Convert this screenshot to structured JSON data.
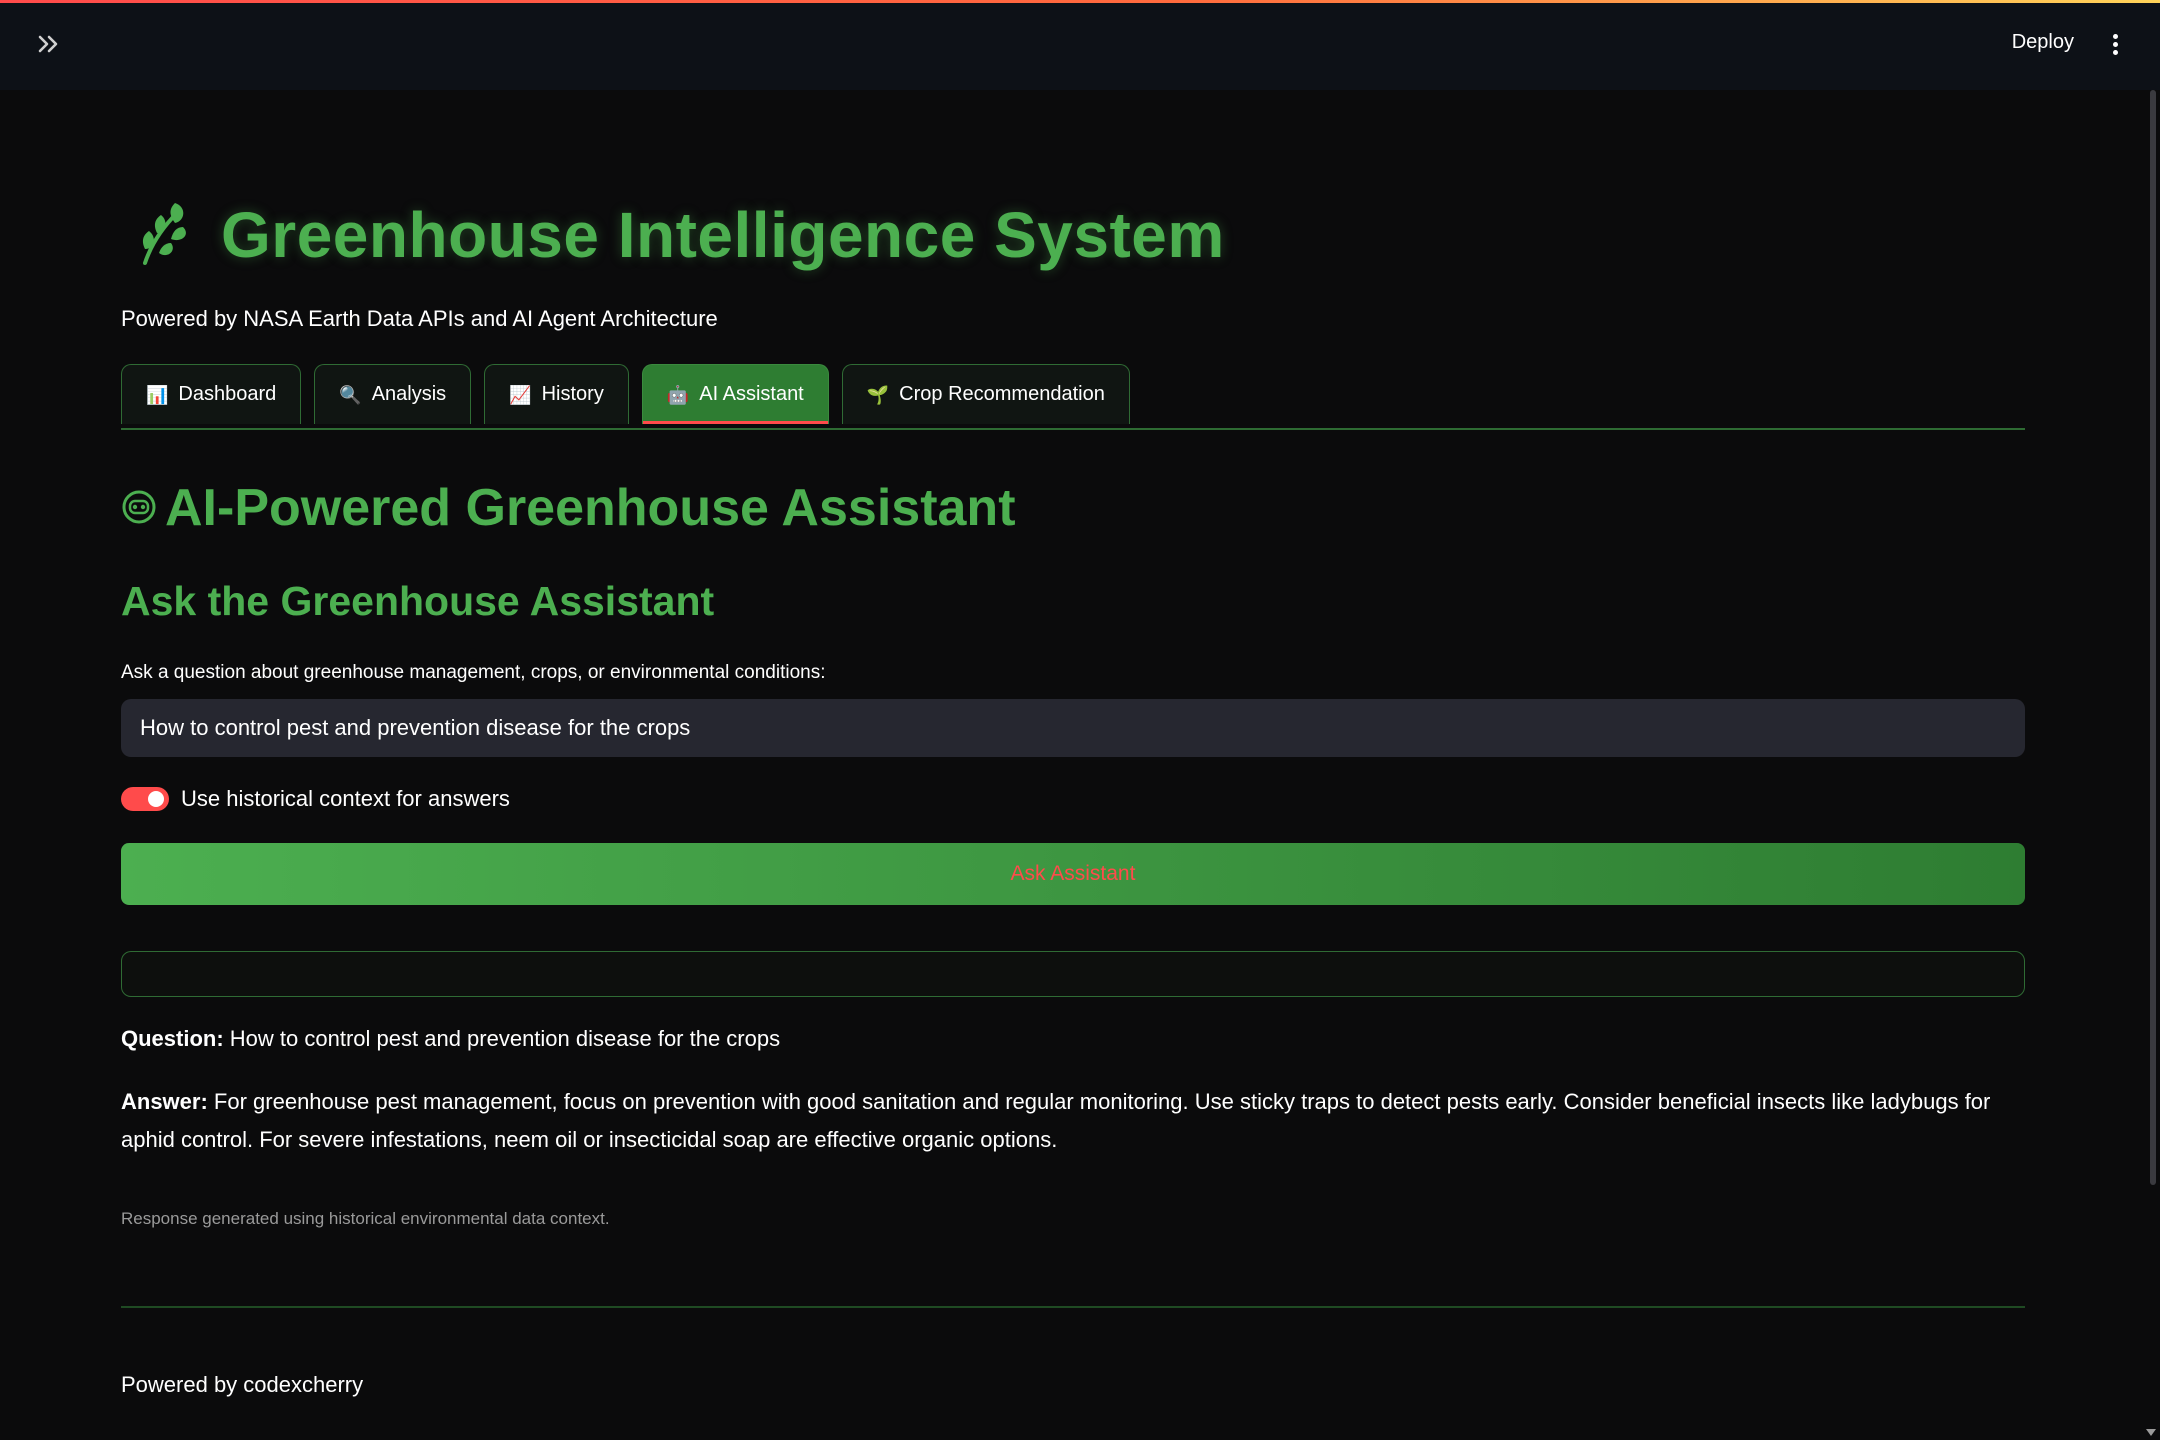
{
  "topbar": {
    "deploy_label": "Deploy",
    "sidebar_toggle_icon": "double-chevron-right-icon",
    "menu_icon": "kebab-menu-icon"
  },
  "app": {
    "title": "Greenhouse Intelligence System",
    "title_icon": "herb-leaf-icon",
    "subtitle": "Powered by NASA Earth Data APIs and AI Agent Architecture"
  },
  "tabs": [
    {
      "icon": "📊",
      "label": "Dashboard",
      "active": false
    },
    {
      "icon": "🔍",
      "label": "Analysis",
      "active": false
    },
    {
      "icon": "📈",
      "label": "History",
      "active": false
    },
    {
      "icon": "🤖",
      "label": "AI Assistant",
      "active": true
    },
    {
      "icon": "🌱",
      "label": "Crop Recommendation",
      "active": false
    }
  ],
  "assistant": {
    "heading": "AI-Powered Greenhouse Assistant",
    "heading_icon": "robot-icon",
    "subheading": "Ask the Greenhouse Assistant",
    "input_label": "Ask a question about greenhouse management, crops, or environmental conditions:",
    "input_value": "How to control pest and prevention disease for the crops",
    "toggle_label": "Use historical context for answers",
    "toggle_on": true,
    "ask_button_label": "Ask Assistant",
    "question_label": "Question:",
    "question_text": "How to control pest and prevention disease for the crops",
    "answer_label": "Answer:",
    "answer_text": "For greenhouse pest management, focus on prevention with good sanitation and regular monitoring. Use sticky traps to detect pests early. Consider beneficial insects like ladybugs for aphid control. For severe infestations, neem oil or insecticidal soap are effective organic options.",
    "caption": "Response generated using historical environmental data context."
  },
  "footer": {
    "text": "Powered by codexcherry"
  },
  "colors": {
    "accent_green": "#4caf50",
    "dark_green": "#2e7d32",
    "toggle_red": "#ff4b4b",
    "background": "#0b0b0c"
  }
}
